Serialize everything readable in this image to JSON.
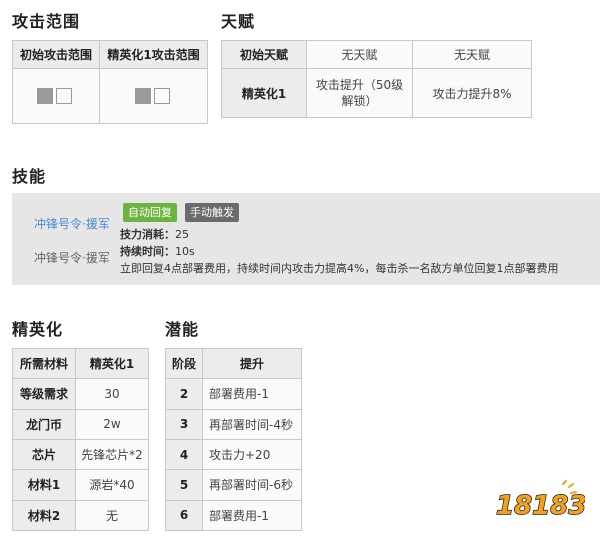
{
  "attack_range": {
    "title": "攻击范围",
    "headers": [
      "初始攻击范围",
      "精英化1攻击范围"
    ]
  },
  "talent": {
    "title": "天赋",
    "rows": [
      {
        "label": "初始天赋",
        "c1": "无天赋",
        "c2": "无天赋"
      },
      {
        "label": "精英化1",
        "c1": "攻击提升（50级解锁）",
        "c2": "攻击力提升8%"
      }
    ]
  },
  "skills": {
    "title": "技能",
    "name_highlight": "冲锋号令·援军",
    "name": "冲锋号令·援军",
    "tag_auto": "自动回复",
    "tag_manual": "手动触发",
    "sp_cost_label": "技力消耗：",
    "sp_cost_value": "25",
    "duration_label": "持续时间：",
    "duration_value": "10s",
    "description": "立即回复4点部署费用，持续时间内攻击力提高4%，每击杀一名敌方单位回复1点部署费用"
  },
  "elite": {
    "title": "精英化",
    "headers": [
      "所需材料",
      "精英化1"
    ],
    "rows": [
      {
        "label": "等级需求",
        "value": "30"
      },
      {
        "label": "龙门币",
        "value": "2w"
      },
      {
        "label": "芯片",
        "value": "先锋芯片*2"
      },
      {
        "label": "材料1",
        "value": "源岩*40"
      },
      {
        "label": "材料2",
        "value": "无"
      }
    ]
  },
  "potential": {
    "title": "潜能",
    "headers": [
      "阶段",
      "提升"
    ],
    "rows": [
      {
        "stage": "2",
        "effect": "部署费用-1"
      },
      {
        "stage": "3",
        "effect": "再部署时间-4秒"
      },
      {
        "stage": "4",
        "effect": "攻击力+20"
      },
      {
        "stage": "5",
        "effect": "再部署时间-6秒"
      },
      {
        "stage": "6",
        "effect": "部署费用-1"
      }
    ]
  },
  "watermark": {
    "text": "18183"
  },
  "colors": {
    "accent_blue": "#4a8ad8",
    "tag_green": "#6cb33f",
    "tag_gray": "#6b6b6b",
    "header_bg": "#ececec"
  }
}
